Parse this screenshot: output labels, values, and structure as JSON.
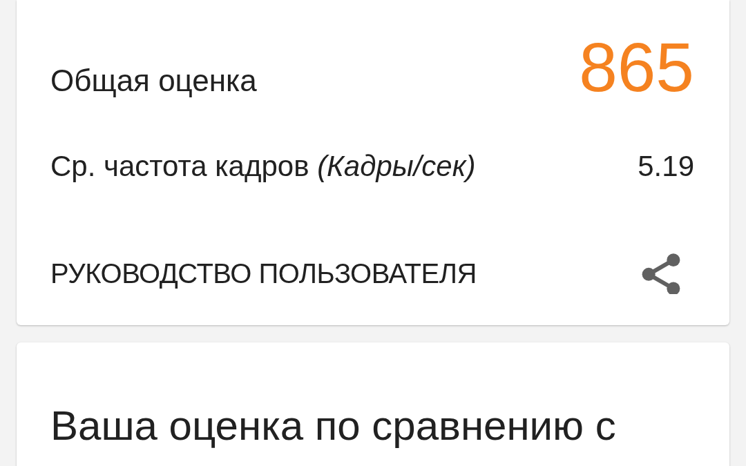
{
  "score_card": {
    "overall_label": "Общая оценка",
    "overall_score": "865",
    "fps_label": "Ср. частота кадров *(Кадры/сек)*",
    "fps_value": "5.19",
    "user_guide_link": "РУКОВОДСТВО ПОЛЬЗОВАТЕЛЯ"
  },
  "comparison_card": {
    "title": "Ваша оценка по сравнению с"
  }
}
